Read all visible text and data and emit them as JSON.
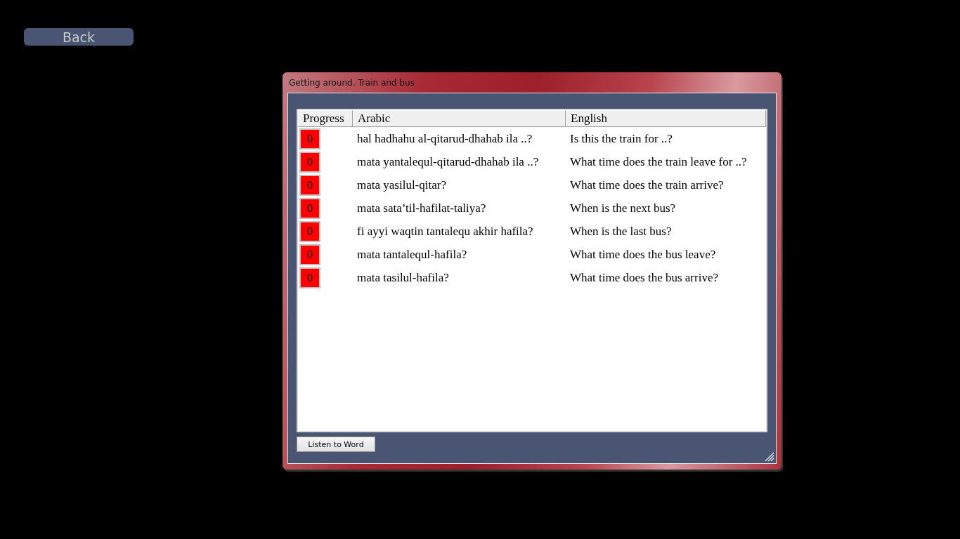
{
  "back_button": "Back",
  "window": {
    "title": "Getting around. Train and bus"
  },
  "table": {
    "columns": [
      "Progress",
      "Arabic",
      "English"
    ],
    "rows": [
      {
        "progress": "0",
        "arabic": "hal hadhahu al-qitarud-dhahab ila ..?",
        "english": "Is this the train for ..?"
      },
      {
        "progress": "0",
        "arabic": "mata yantalequl-qitarud-dhahab ila ..?",
        "english": "What time does the train leave for ..?"
      },
      {
        "progress": "0",
        "arabic": "mata yasilul-qitar?",
        "english": "What time does the train arrive?"
      },
      {
        "progress": "0",
        "arabic": "mata sata’til-hafilat-taliya?",
        "english": "When is the next bus?"
      },
      {
        "progress": "0",
        "arabic": "fi ayyi waqtin tantalequ akhir hafila?",
        "english": "When is the last bus?"
      },
      {
        "progress": "0",
        "arabic": "mata tantalequl-hafila?",
        "english": "What time does the bus leave?"
      },
      {
        "progress": "0",
        "arabic": "mata tasilul-hafila?",
        "english": "What time does the bus arrive?"
      }
    ]
  },
  "buttons": [
    "Listen to Word"
  ]
}
